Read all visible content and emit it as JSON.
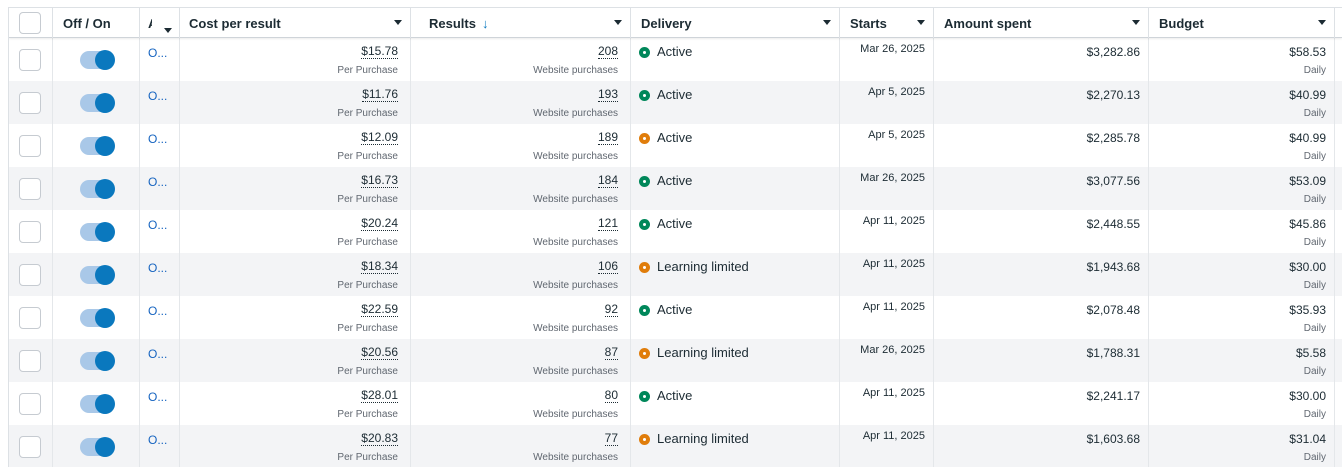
{
  "columns": {
    "off_on": "Off / On",
    "truncated": "A",
    "cost_per_result": "Cost per result",
    "results": "Results",
    "results_sort_icon": "arrow-down-icon",
    "delivery": "Delivery",
    "starts": "Starts",
    "amount_spent": "Amount spent",
    "budget": "Budget"
  },
  "colors": {
    "active": "#00875a",
    "learning_limited": "#e07d0b",
    "toggle_on": "#0a78be",
    "link": "#1664c0"
  },
  "rows": [
    {
      "toggle_on": true,
      "name_truncated": "O...",
      "cost": "$15.78",
      "cost_sub": "Per Purchase",
      "results": "208",
      "results_sub": "Website purchases",
      "delivery": "Active",
      "delivery_status": "active",
      "starts": "Mar 26, 2025",
      "amount_spent": "$3,282.86",
      "budget": "$58.53",
      "budget_sub": "Daily"
    },
    {
      "toggle_on": true,
      "name_truncated": "O...",
      "cost": "$11.76",
      "cost_sub": "Per Purchase",
      "results": "193",
      "results_sub": "Website purchases",
      "delivery": "Active",
      "delivery_status": "active",
      "starts": "Apr 5, 2025",
      "amount_spent": "$2,270.13",
      "budget": "$40.99",
      "budget_sub": "Daily"
    },
    {
      "toggle_on": true,
      "name_truncated": "O...",
      "cost": "$12.09",
      "cost_sub": "Per Purchase",
      "results": "189",
      "results_sub": "Website purchases",
      "delivery": "Active",
      "delivery_status": "learning",
      "starts": "Apr 5, 2025",
      "amount_spent": "$2,285.78",
      "budget": "$40.99",
      "budget_sub": "Daily"
    },
    {
      "toggle_on": true,
      "name_truncated": "O...",
      "cost": "$16.73",
      "cost_sub": "Per Purchase",
      "results": "184",
      "results_sub": "Website purchases",
      "delivery": "Active",
      "delivery_status": "active",
      "starts": "Mar 26, 2025",
      "amount_spent": "$3,077.56",
      "budget": "$53.09",
      "budget_sub": "Daily"
    },
    {
      "toggle_on": true,
      "name_truncated": "O...",
      "cost": "$20.24",
      "cost_sub": "Per Purchase",
      "results": "121",
      "results_sub": "Website purchases",
      "delivery": "Active",
      "delivery_status": "active",
      "starts": "Apr 11, 2025",
      "amount_spent": "$2,448.55",
      "budget": "$45.86",
      "budget_sub": "Daily"
    },
    {
      "toggle_on": true,
      "name_truncated": "O...",
      "cost": "$18.34",
      "cost_sub": "Per Purchase",
      "results": "106",
      "results_sub": "Website purchases",
      "delivery": "Learning limited",
      "delivery_status": "learning",
      "starts": "Apr 11, 2025",
      "amount_spent": "$1,943.68",
      "budget": "$30.00",
      "budget_sub": "Daily"
    },
    {
      "toggle_on": true,
      "name_truncated": "O...",
      "cost": "$22.59",
      "cost_sub": "Per Purchase",
      "results": "92",
      "results_sub": "Website purchases",
      "delivery": "Active",
      "delivery_status": "active",
      "starts": "Apr 11, 2025",
      "amount_spent": "$2,078.48",
      "budget": "$35.93",
      "budget_sub": "Daily"
    },
    {
      "toggle_on": true,
      "name_truncated": "O...",
      "cost": "$20.56",
      "cost_sub": "Per Purchase",
      "results": "87",
      "results_sub": "Website purchases",
      "delivery": "Learning limited",
      "delivery_status": "learning",
      "starts": "Mar 26, 2025",
      "amount_spent": "$1,788.31",
      "budget": "$5.58",
      "budget_sub": "Daily"
    },
    {
      "toggle_on": true,
      "name_truncated": "O...",
      "cost": "$28.01",
      "cost_sub": "Per Purchase",
      "results": "80",
      "results_sub": "Website purchases",
      "delivery": "Active",
      "delivery_status": "active",
      "starts": "Apr 11, 2025",
      "amount_spent": "$2,241.17",
      "budget": "$30.00",
      "budget_sub": "Daily"
    },
    {
      "toggle_on": true,
      "name_truncated": "O...",
      "cost": "$20.83",
      "cost_sub": "Per Purchase",
      "results": "77",
      "results_sub": "Website purchases",
      "delivery": "Learning limited",
      "delivery_status": "learning",
      "starts": "Apr 11, 2025",
      "amount_spent": "$1,603.68",
      "budget": "$31.04",
      "budget_sub": "Daily"
    }
  ]
}
